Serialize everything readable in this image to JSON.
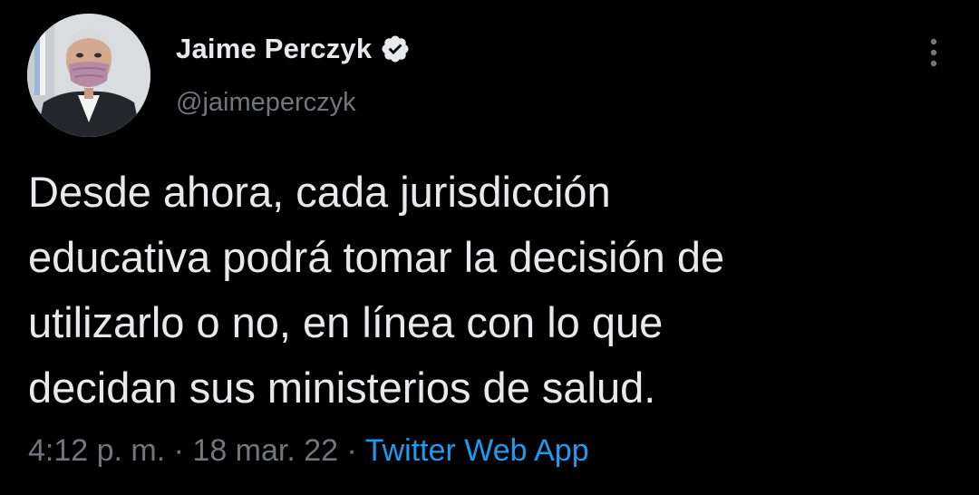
{
  "tweet": {
    "author": {
      "display_name": "Jaime Perczyk",
      "handle": "@jaimeperczyk",
      "verified": true,
      "avatar_icon": "profile-photo"
    },
    "text": "Desde ahora, cada jurisdicción\neducativa podrá tomar la decisión de\nutilizarlo o no, en línea con lo que\ndecidan sus ministerios de salud.",
    "time": "4:12 p. m.",
    "separator": " · ",
    "date": "18 mar. 22",
    "source": "Twitter Web App",
    "more_icon": "more-vertical-icon"
  },
  "colors": {
    "background": "#000000",
    "primary_text": "#e7e9ea",
    "secondary_text": "#71767b",
    "accent": "#1d9bf0",
    "verified_badge": "#e7e9ea"
  }
}
